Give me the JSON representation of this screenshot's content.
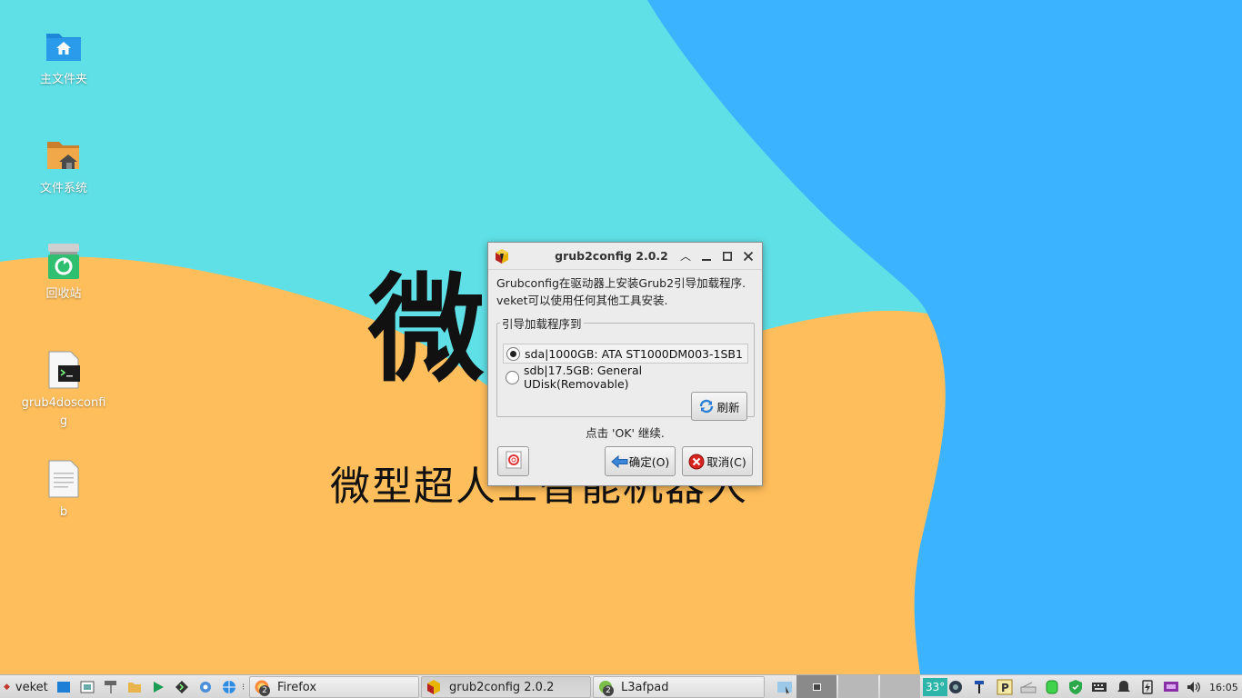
{
  "wallpaper": {
    "big_char": "微",
    "slogan": "微型超人工智能机器人",
    "colors": {
      "cyan": "#5fe0e6",
      "blue": "#3bb3ff",
      "orange": "#ffbe5c"
    }
  },
  "desktop_icons": [
    {
      "label": "主文件夹",
      "icon": "home-folder-icon"
    },
    {
      "label": "文件系统",
      "icon": "filesystem-icon"
    },
    {
      "label": "回收站",
      "icon": "recycle-bin-icon"
    },
    {
      "label": "grub4dosconfig",
      "icon": "terminal-script-icon"
    },
    {
      "label": "b",
      "icon": "text-file-icon"
    }
  ],
  "dialog": {
    "title": "grub2config 2.0.2",
    "desc_line1": "Grubconfig在驱动器上安装Grub2引导加载程序.",
    "desc_line2": "veket可以使用任何其他工具安装.",
    "group_label": "引导加载程序到",
    "options": [
      {
        "label": "sda|1000GB: ATA ST1000DM003-1SB1",
        "selected": true
      },
      {
        "label": "sdb|17.5GB: General UDisk(Removable)",
        "selected": false
      }
    ],
    "refresh_label": "刷新",
    "hint": "点击 'OK' 继续.",
    "ok_label": "确定(O)",
    "cancel_label": "取消(C)"
  },
  "taskbar": {
    "menu_label": "veket",
    "tasks": [
      {
        "label": "Firefox",
        "badge": "2",
        "active": false
      },
      {
        "label": "grub2config 2.0.2",
        "badge": "",
        "active": true
      },
      {
        "label": "L3afpad",
        "badge": "2",
        "active": false
      }
    ],
    "temperature": "33°",
    "clock": "16:05"
  }
}
